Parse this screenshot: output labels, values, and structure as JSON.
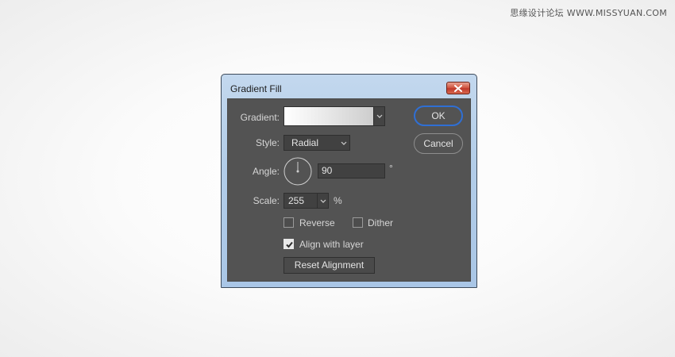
{
  "watermark": "思缘设计论坛 WWW.MISSYUAN.COM",
  "dialog": {
    "title": "Gradient Fill",
    "close_icon": "close-icon",
    "gradient": {
      "label": "Gradient:",
      "start_color": "#ffffff",
      "end_color": "#cdcdcd"
    },
    "style": {
      "label": "Style:",
      "value": "Radial"
    },
    "angle": {
      "label": "Angle:",
      "value": "90",
      "unit": "°"
    },
    "scale": {
      "label": "Scale:",
      "value": "255",
      "unit": "%"
    },
    "reverse": {
      "label": "Reverse",
      "checked": false
    },
    "dither": {
      "label": "Dither",
      "checked": false
    },
    "align_with_layer": {
      "label": "Align with layer",
      "checked": true
    },
    "reset_alignment_label": "Reset Alignment",
    "ok_label": "OK",
    "cancel_label": "Cancel"
  },
  "colors": {
    "panel_bg": "#535353",
    "frame": "#b3cde8",
    "ok_focus": "#2f6fd4",
    "close_red": "#c0392b"
  }
}
